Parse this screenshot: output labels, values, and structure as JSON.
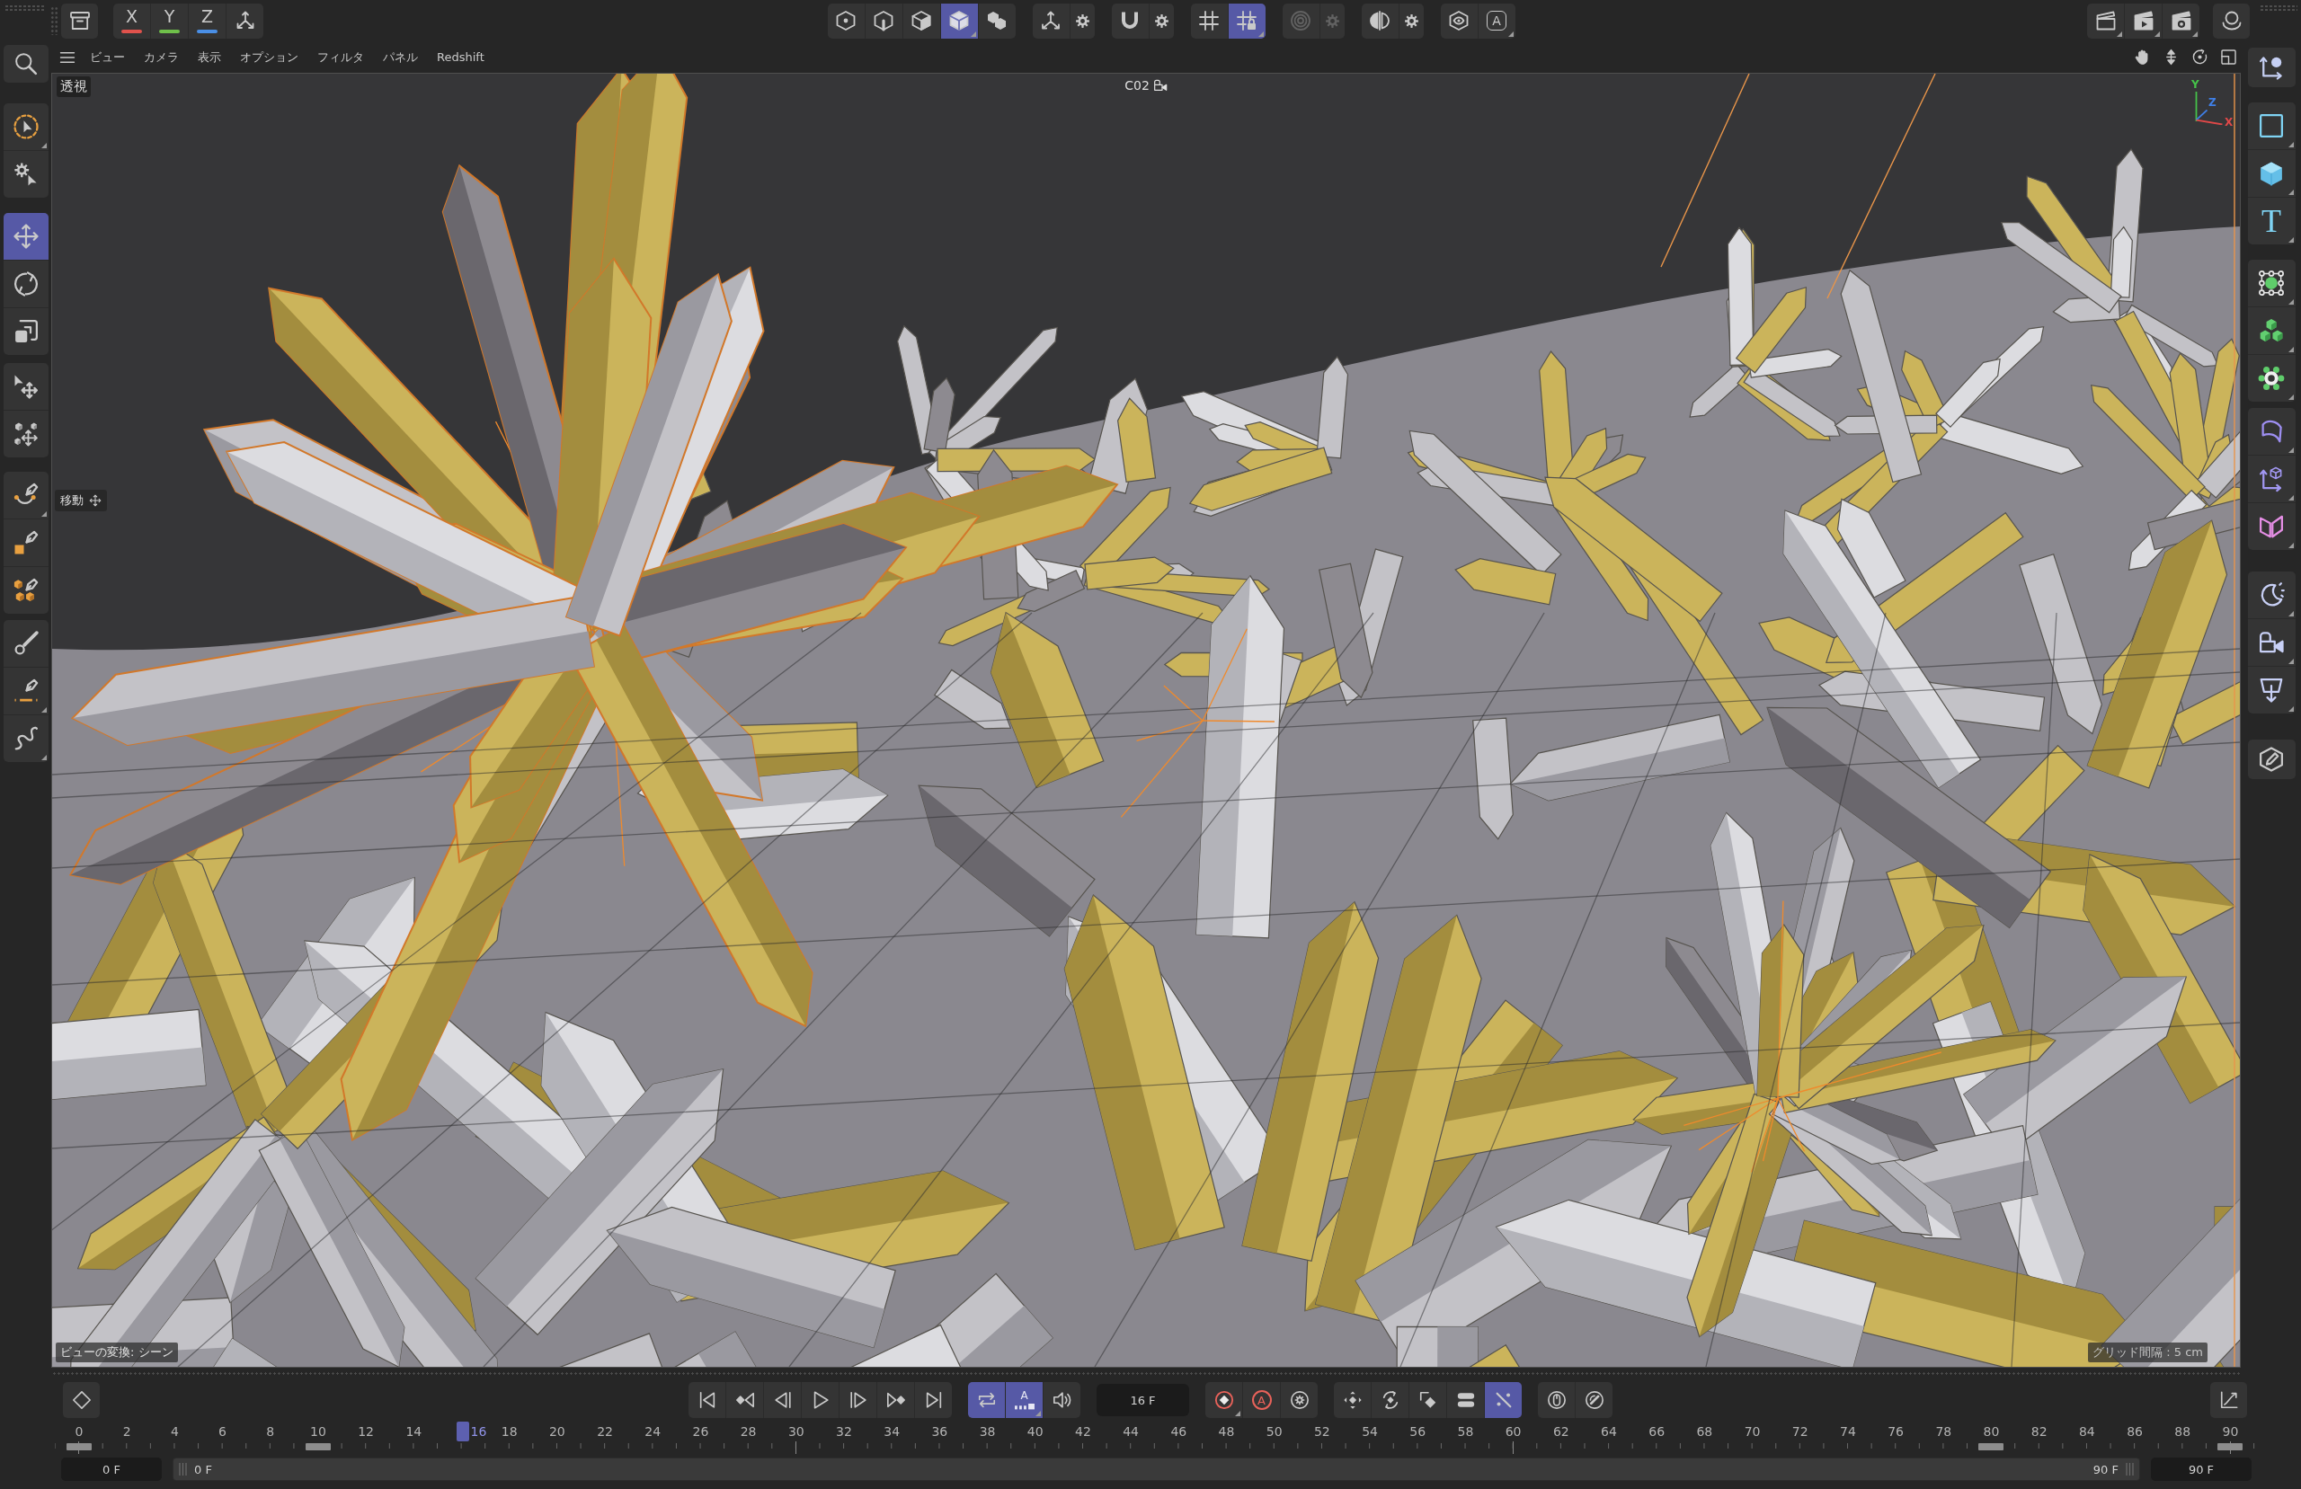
{
  "top_toolbar": {
    "left": [
      {
        "tools": [
          {
            "kind": "archive",
            "selected": false,
            "menu": false
          }
        ]
      },
      {
        "tools": [
          {
            "kind": "axis_lock",
            "label": "X",
            "color": "#e0524c",
            "selected": false,
            "menu": false
          },
          {
            "kind": "axis_lock",
            "label": "Y",
            "color": "#6fc04a",
            "selected": false,
            "menu": false
          },
          {
            "kind": "axis_lock",
            "label": "Z",
            "color": "#4a8fe6",
            "selected": false,
            "menu": false
          },
          {
            "kind": "coordinates",
            "selected": false,
            "menu": false
          }
        ]
      }
    ],
    "center": [
      {
        "tools": [
          {
            "kind": "points",
            "selected": false,
            "menu": false
          },
          {
            "kind": "edges",
            "selected": false,
            "menu": false
          },
          {
            "kind": "polygons",
            "selected": false,
            "menu": false
          },
          {
            "kind": "model",
            "selected": true,
            "menu": true
          },
          {
            "kind": "uv",
            "selected": false,
            "menu": false
          }
        ]
      },
      {
        "tools": [
          {
            "kind": "axis",
            "selected": false,
            "menu": false
          },
          {
            "kind": "gear",
            "selected": false,
            "menu": false
          }
        ]
      },
      {
        "tools": [
          {
            "kind": "snap",
            "selected": false,
            "menu": false
          },
          {
            "kind": "gear",
            "selected": false,
            "menu": false
          }
        ]
      },
      {
        "tools": [
          {
            "kind": "grid",
            "selected": false,
            "menu": false
          },
          {
            "kind": "grid_lock",
            "selected": true,
            "menu": true
          }
        ]
      },
      {
        "tools": [
          {
            "kind": "target",
            "selected": false,
            "menu": false,
            "disabled": true
          },
          {
            "kind": "gear",
            "selected": false,
            "menu": false,
            "disabled": true
          }
        ]
      },
      {
        "tools": [
          {
            "kind": "symmetry",
            "selected": false,
            "menu": false
          },
          {
            "kind": "gear",
            "selected": false,
            "menu": false
          }
        ]
      },
      {
        "tools": [
          {
            "kind": "eye",
            "selected": false,
            "menu": false
          },
          {
            "kind": "letter_hexagon",
            "label": "A",
            "selected": false,
            "menu": true
          }
        ]
      }
    ],
    "right": [
      {
        "tools": [
          {
            "kind": "render_region",
            "selected": false,
            "menu": true
          },
          {
            "kind": "render_view",
            "selected": false,
            "menu": true
          },
          {
            "kind": "render_settings",
            "selected": false,
            "menu": true
          }
        ]
      },
      {
        "tools": [
          {
            "kind": "dome",
            "selected": false,
            "menu": false
          }
        ]
      }
    ]
  },
  "view_menu": {
    "menu_button": {
      "kind": "menu",
      "selected": false,
      "menu": false
    },
    "items": [
      "ビュー",
      "カメラ",
      "表示",
      "オプション",
      "フィルタ",
      "パネル",
      "Redshift"
    ],
    "navigation": [
      {
        "kind": "pan",
        "selected": false,
        "menu": false
      },
      {
        "kind": "dolly",
        "selected": false,
        "menu": false
      },
      {
        "kind": "orbit",
        "selected": false,
        "menu": false
      },
      {
        "kind": "maximize",
        "selected": false,
        "menu": false
      }
    ]
  },
  "left_toolbar": {
    "groups": [
      {
        "tools": [
          {
            "kind": "search",
            "selected": false,
            "menu": false
          }
        ]
      },
      {
        "tools": [
          {
            "kind": "live_selection",
            "selected": false,
            "menu": true
          },
          {
            "kind": "selection_settings",
            "selected": false,
            "menu": false
          }
        ]
      },
      {
        "tools": [
          {
            "kind": "move",
            "selected": true,
            "menu": false
          },
          {
            "kind": "rotate",
            "selected": false,
            "menu": false
          },
          {
            "kind": "scale",
            "selected": false,
            "menu": false
          }
        ]
      },
      {
        "tools": [
          {
            "kind": "transform",
            "selected": false,
            "menu": false
          },
          {
            "kind": "placement",
            "selected": false,
            "menu": false
          }
        ]
      },
      {
        "tools": [
          {
            "kind": "spline_pen",
            "selected": false,
            "menu": true
          },
          {
            "kind": "poly_pen",
            "selected": false,
            "menu": false
          },
          {
            "kind": "cube_pen",
            "selected": false,
            "menu": false
          }
        ]
      },
      {
        "tools": [
          {
            "kind": "brush",
            "selected": false,
            "menu": false
          },
          {
            "kind": "line_pen",
            "selected": false,
            "menu": true
          },
          {
            "kind": "spline_sketch",
            "selected": false,
            "menu": true
          }
        ]
      }
    ]
  },
  "right_toolbar": {
    "groups": [
      {
        "tools": [
          {
            "kind": "coord_sys",
            "selected": false,
            "menu": false
          }
        ]
      },
      {
        "tools": [
          {
            "kind": "spline",
            "selected": false,
            "menu": true
          },
          {
            "kind": "cube_obj",
            "selected": false,
            "menu": true
          },
          {
            "kind": "text",
            "label": "T",
            "selected": false,
            "menu": true
          }
        ]
      },
      {
        "tools": [
          {
            "kind": "selection_obj",
            "selected": false,
            "menu": true
          },
          {
            "kind": "cloner",
            "selected": false,
            "menu": true
          },
          {
            "kind": "effector",
            "selected": false,
            "menu": true
          }
        ]
      },
      {
        "tools": [
          {
            "kind": "deformer",
            "selected": false,
            "menu": true
          },
          {
            "kind": "field",
            "selected": false,
            "menu": true
          },
          {
            "kind": "volume",
            "selected": false,
            "menu": true
          }
        ]
      },
      {
        "tools": [
          {
            "kind": "light",
            "selected": false,
            "menu": true
          },
          {
            "kind": "camera",
            "selected": false,
            "menu": true
          },
          {
            "kind": "scene",
            "selected": false,
            "menu": true
          }
        ]
      },
      {
        "tools": [
          {
            "kind": "edit",
            "selected": false,
            "menu": false
          }
        ]
      }
    ]
  },
  "viewport": {
    "projection": "透視",
    "camera": "C02",
    "axis_gizmo": [
      {
        "label": "Y",
        "color": "#46c24a"
      },
      {
        "label": "Z",
        "color": "#3f7fe6"
      },
      {
        "label": "X",
        "color": "#e04848"
      }
    ],
    "tool_hint": "移動",
    "view_transform": "ビューの変換: シーン",
    "grid_spacing": "グリッド間隔 : 5 cm"
  },
  "timeline": {
    "key_button": {
      "kind": "key",
      "selected": false,
      "menu": false
    },
    "transport": [
      {
        "tools": [
          {
            "kind": "first",
            "selected": false,
            "menu": false
          },
          {
            "kind": "prev_key",
            "selected": false,
            "menu": false
          },
          {
            "kind": "prev_frame",
            "selected": false,
            "menu": false
          },
          {
            "kind": "play",
            "selected": false,
            "menu": false
          },
          {
            "kind": "next_frame",
            "selected": false,
            "menu": false
          },
          {
            "kind": "next_key",
            "selected": false,
            "menu": false
          },
          {
            "kind": "last",
            "selected": false,
            "menu": false
          }
        ]
      },
      {
        "tools": [
          {
            "kind": "loop",
            "selected": true,
            "menu": false
          },
          {
            "kind": "timeline_mode",
            "label": "A",
            "selected": true,
            "menu": true
          },
          {
            "kind": "speaker",
            "selected": false,
            "menu": false
          }
        ]
      }
    ],
    "frame_field": "16 F",
    "key_groups": [
      {
        "tools": [
          {
            "kind": "record",
            "selected": false,
            "menu": true
          },
          {
            "kind": "autokey",
            "label": "A",
            "selected": false,
            "menu": false
          },
          {
            "kind": "key_settings",
            "selected": false,
            "menu": false
          }
        ]
      },
      {
        "tools": [
          {
            "kind": "key_pos",
            "selected": false,
            "menu": false
          },
          {
            "kind": "key_rot",
            "selected": false,
            "menu": false
          },
          {
            "kind": "key_scale",
            "selected": false,
            "menu": false
          },
          {
            "kind": "key_param",
            "selected": false,
            "menu": false
          },
          {
            "kind": "key_pla",
            "selected": true,
            "menu": false
          }
        ]
      },
      {
        "tools": [
          {
            "kind": "mouse",
            "selected": false,
            "menu": false
          },
          {
            "kind": "dial",
            "selected": false,
            "menu": false
          }
        ]
      }
    ],
    "graph_button": {
      "kind": "graph",
      "selected": false,
      "menu": false
    },
    "ruler": [
      {
        "label": "0",
        "selected": false,
        "marker": true
      },
      {
        "label": "2",
        "selected": false,
        "marker": false
      },
      {
        "label": "4",
        "selected": false,
        "marker": false
      },
      {
        "label": "6",
        "selected": false,
        "marker": false
      },
      {
        "label": "8",
        "selected": false,
        "marker": false
      },
      {
        "label": "10",
        "selected": false,
        "marker": true
      },
      {
        "label": "12",
        "selected": false,
        "marker": false
      },
      {
        "label": "14",
        "selected": false,
        "marker": false
      },
      {
        "label": "16",
        "selected": true,
        "marker": false
      },
      {
        "label": "18",
        "selected": false,
        "marker": false
      },
      {
        "label": "20",
        "selected": false,
        "marker": false
      },
      {
        "label": "22",
        "selected": false,
        "marker": false
      },
      {
        "label": "24",
        "selected": false,
        "marker": false
      },
      {
        "label": "26",
        "selected": false,
        "marker": false
      },
      {
        "label": "28",
        "selected": false,
        "marker": false
      },
      {
        "label": "30",
        "selected": false,
        "marker": false
      },
      {
        "label": "32",
        "selected": false,
        "marker": false
      },
      {
        "label": "34",
        "selected": false,
        "marker": false
      },
      {
        "label": "36",
        "selected": false,
        "marker": false
      },
      {
        "label": "38",
        "selected": false,
        "marker": false
      },
      {
        "label": "40",
        "selected": false,
        "marker": false
      },
      {
        "label": "42",
        "selected": false,
        "marker": false
      },
      {
        "label": "44",
        "selected": false,
        "marker": false
      },
      {
        "label": "46",
        "selected": false,
        "marker": false
      },
      {
        "label": "48",
        "selected": false,
        "marker": false
      },
      {
        "label": "50",
        "selected": false,
        "marker": false
      },
      {
        "label": "52",
        "selected": false,
        "marker": false
      },
      {
        "label": "54",
        "selected": false,
        "marker": false
      },
      {
        "label": "56",
        "selected": false,
        "marker": false
      },
      {
        "label": "58",
        "selected": false,
        "marker": false
      },
      {
        "label": "60",
        "selected": false,
        "marker": false
      },
      {
        "label": "62",
        "selected": false,
        "marker": false
      },
      {
        "label": "64",
        "selected": false,
        "marker": false
      },
      {
        "label": "66",
        "selected": false,
        "marker": false
      },
      {
        "label": "68",
        "selected": false,
        "marker": false
      },
      {
        "label": "70",
        "selected": false,
        "marker": false
      },
      {
        "label": "72",
        "selected": false,
        "marker": false
      },
      {
        "label": "74",
        "selected": false,
        "marker": false
      },
      {
        "label": "76",
        "selected": false,
        "marker": false
      },
      {
        "label": "78",
        "selected": false,
        "marker": false
      },
      {
        "label": "80",
        "selected": false,
        "marker": true
      },
      {
        "label": "82",
        "selected": false,
        "marker": false
      },
      {
        "label": "84",
        "selected": false,
        "marker": false
      },
      {
        "label": "86",
        "selected": false,
        "marker": false
      },
      {
        "label": "88",
        "selected": false,
        "marker": false
      },
      {
        "label": "90",
        "selected": false,
        "marker": true
      }
    ],
    "start_field": "0 F",
    "range_slider": {
      "start": "0 F",
      "end": "90 F",
      "level": 1
    },
    "end_field": "90 F"
  }
}
